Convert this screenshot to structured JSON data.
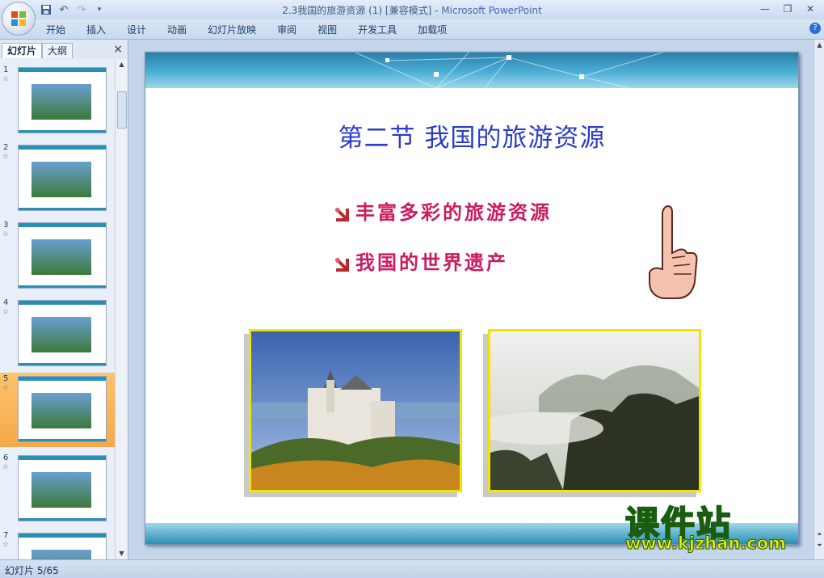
{
  "window": {
    "title": "2.3我国的旅游资源 (1) [兼容模式] -",
    "app_name": "Microsoft PowerPoint"
  },
  "ribbon": {
    "tabs": [
      "开始",
      "插入",
      "设计",
      "动画",
      "幻灯片放映",
      "审阅",
      "视图",
      "开发工具",
      "加载项"
    ]
  },
  "panel": {
    "tab_slides": "幻灯片",
    "tab_outline": "大纲",
    "close": "×",
    "slides": [
      {
        "num": "1"
      },
      {
        "num": "2"
      },
      {
        "num": "3"
      },
      {
        "num": "4"
      },
      {
        "num": "5",
        "selected": true
      },
      {
        "num": "6"
      },
      {
        "num": "7"
      }
    ]
  },
  "slide": {
    "title": "第二节  我国的旅游资源",
    "bullets": [
      "丰富多彩的旅游资源",
      "我国的世界遗产"
    ]
  },
  "watermark": {
    "title": "课件站",
    "url": "www.kjzhan.com"
  },
  "status": {
    "slide_counter": "幻灯片 5/65"
  },
  "colors": {
    "title_blue": "#2c3cc8",
    "bullet_pink": "#cc1b62",
    "photo_border": "#f2e500",
    "selected_thumb": "#f4a94a"
  }
}
